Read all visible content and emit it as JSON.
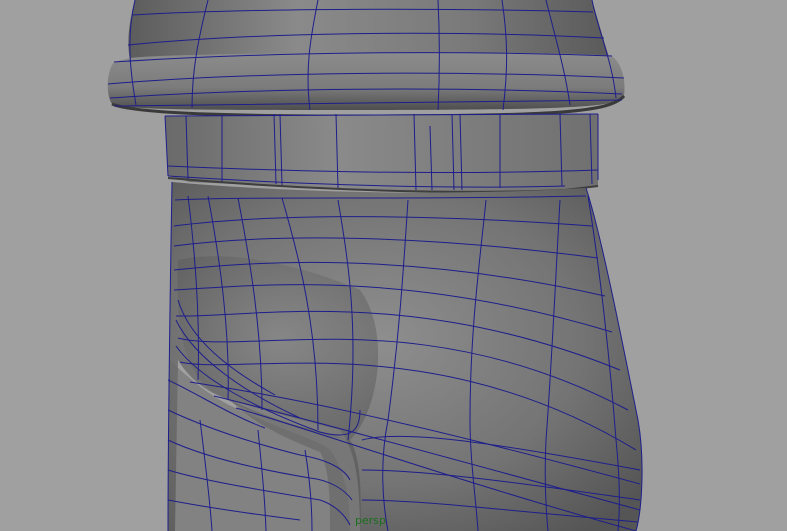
{
  "viewport": {
    "camera_label": "persp",
    "colors": {
      "background": "#a0a0a0",
      "wireframe": "#1e1e8c",
      "camera_label": "#1d6e1d"
    }
  }
}
